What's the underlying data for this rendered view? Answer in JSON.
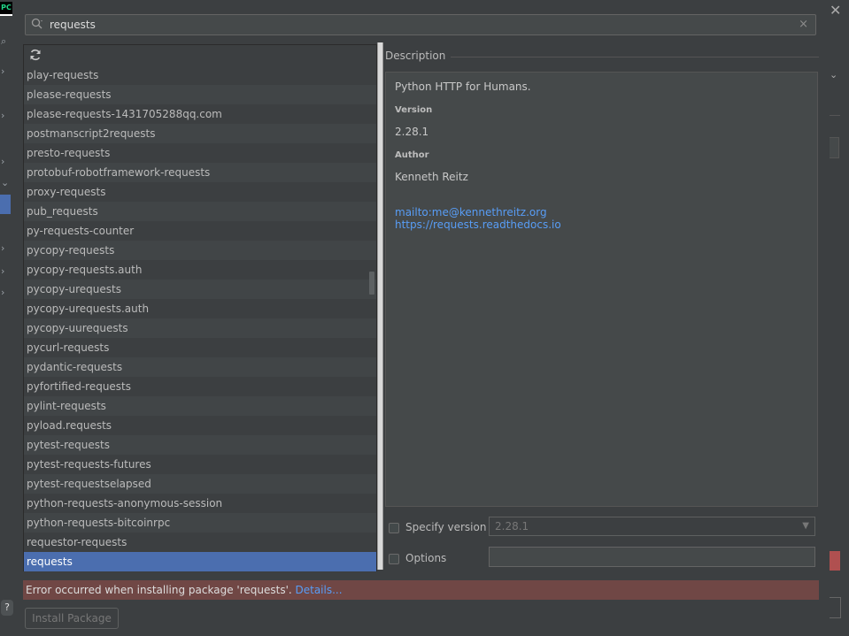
{
  "background_ide": {
    "logo_text": "PC"
  },
  "search": {
    "value": "requests",
    "clear_glyph": "×"
  },
  "packages": [
    "play-requests",
    "please-requests",
    "please-requests-1431705288qq.com",
    "postmanscript2requests",
    "presto-requests",
    "protobuf-robotframework-requests",
    "proxy-requests",
    "pub_requests",
    "py-requests-counter",
    "pycopy-requests",
    "pycopy-requests.auth",
    "pycopy-urequests",
    "pycopy-urequests.auth",
    "pycopy-uurequests",
    "pycurl-requests",
    "pydantic-requests",
    "pyfortified-requests",
    "pylint-requests",
    "pyload.requests",
    "pytest-requests",
    "pytest-requests-futures",
    "pytest-requestselapsed",
    "python-requests-anonymous-session",
    "python-requests-bitcoinrpc",
    "requestor-requests",
    "requests"
  ],
  "selected_package": "requests",
  "description": {
    "header": "Description",
    "summary": "Python HTTP for Humans.",
    "version_label": "Version",
    "version": "2.28.1",
    "author_label": "Author",
    "author": "Kenneth Reitz",
    "email_link": "mailto:me@kennethreitz.org",
    "homepage_link": "https://requests.readthedocs.io"
  },
  "options": {
    "specify_version_label": "Specify version",
    "specify_version_value": "2.28.1",
    "options_label": "Options",
    "options_value": ""
  },
  "error": {
    "message": "Error occurred when installing package 'requests'. ",
    "details_link": "Details..."
  },
  "install_button": "Install Package",
  "colors": {
    "background": "#3c3f41",
    "selection": "#4b6eaf",
    "link": "#589df6",
    "error_banner": "#704745"
  }
}
